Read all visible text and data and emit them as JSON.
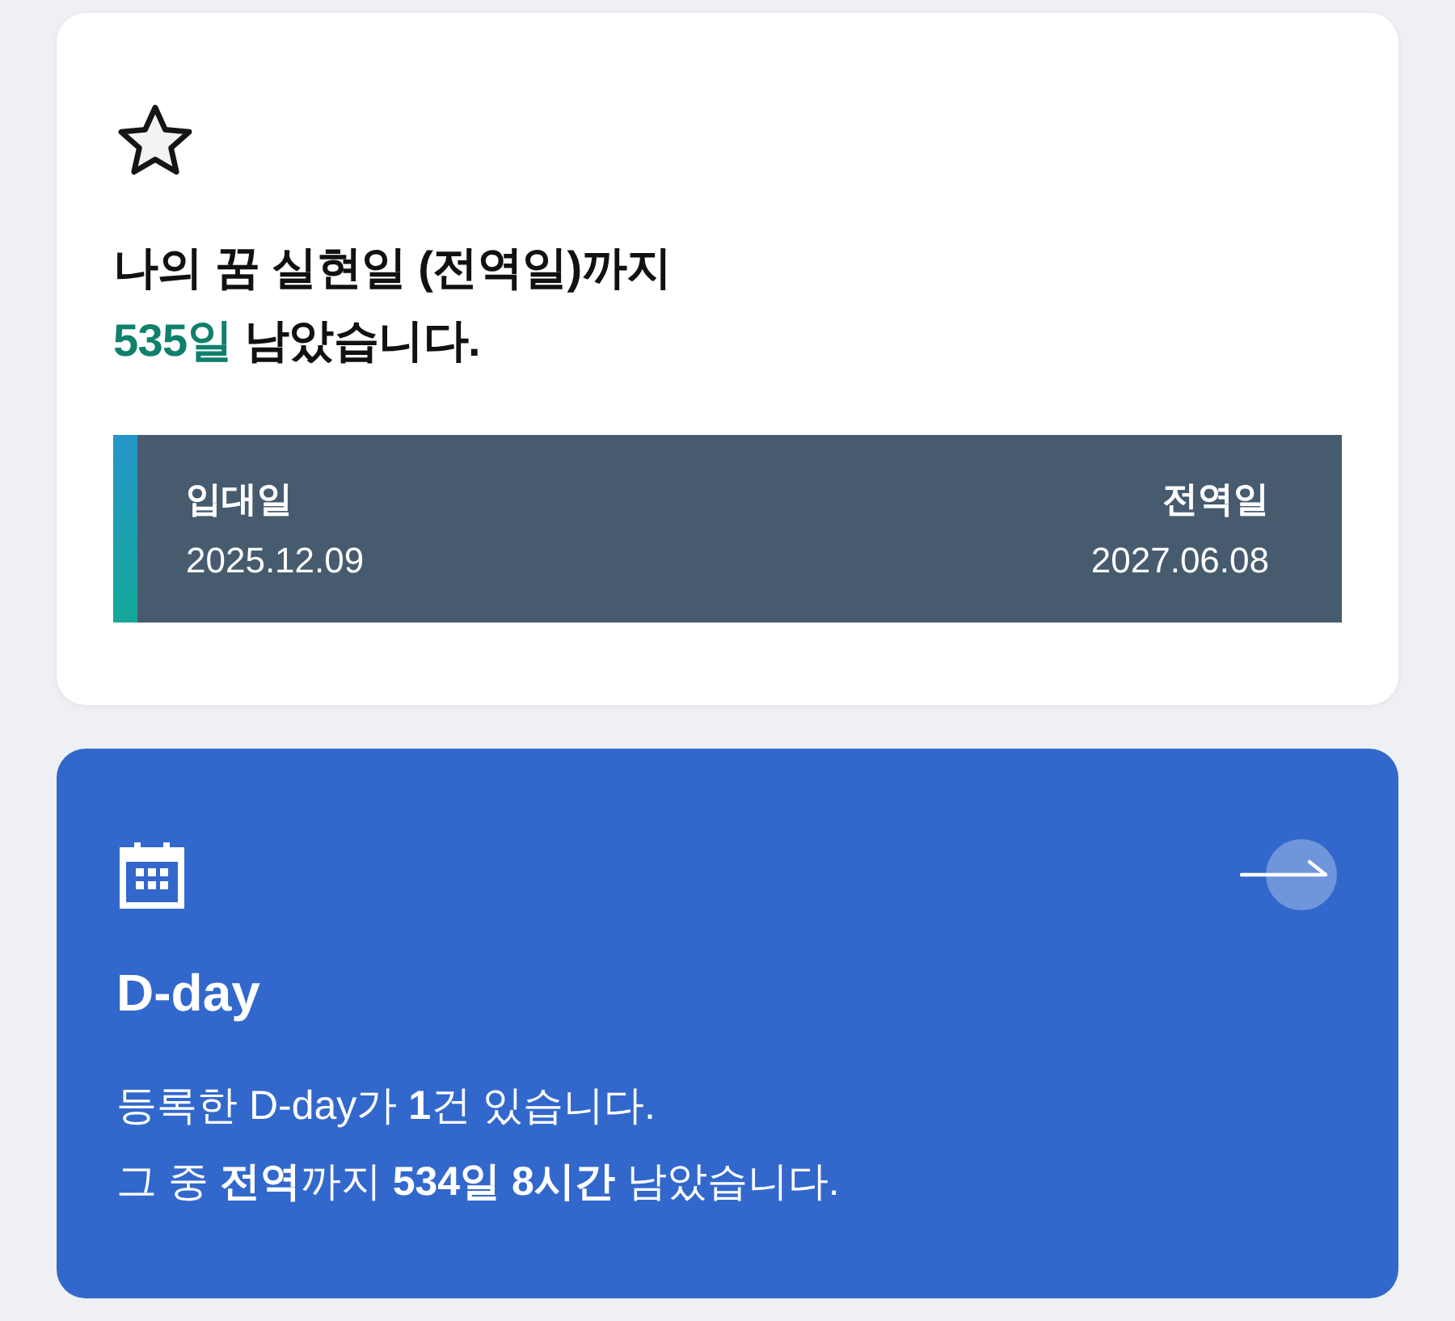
{
  "dream_card": {
    "headline": {
      "text": "나의 꿈 실현일 (전역일)까지",
      "count": "535일",
      "rest": "남았습니다."
    },
    "dates": [
      {
        "label": "입대일",
        "value": "2025.12.09"
      },
      {
        "label": "전역일",
        "value": "2027.06.08"
      }
    ]
  },
  "dday_card": {
    "title": "D-day",
    "lines": [
      "등록한 D-day가 **1**건 있습니다.",
      "그 중 **전역**까지 **534일 8시간** 남았습니다."
    ]
  }
}
